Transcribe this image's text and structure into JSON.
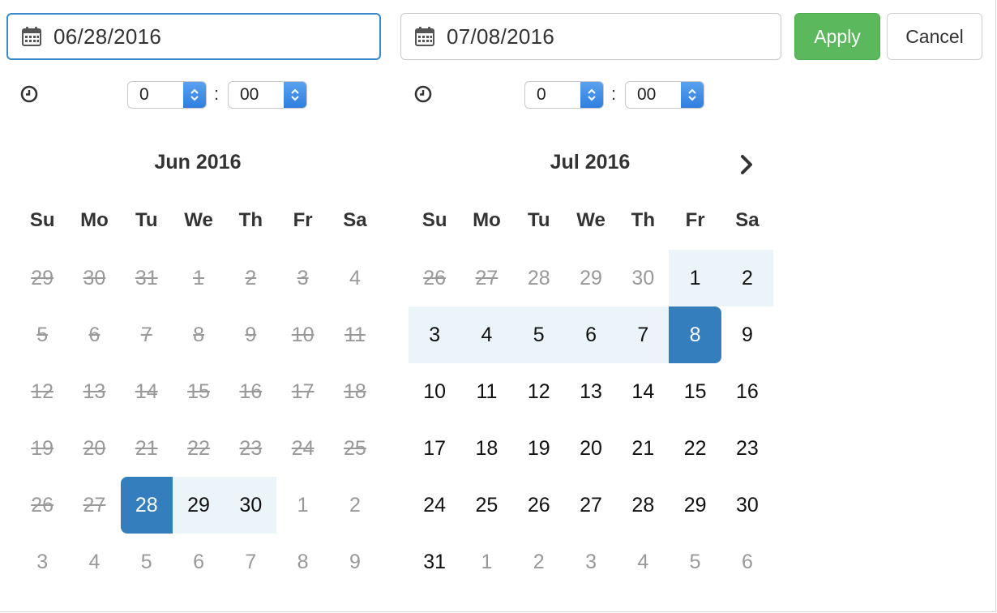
{
  "inputs": {
    "start_date": "06/28/2016",
    "end_date": "07/08/2016"
  },
  "buttons": {
    "apply": "Apply",
    "cancel": "Cancel"
  },
  "time": {
    "left": {
      "hour": "0",
      "separator": ":",
      "minute": "00"
    },
    "right": {
      "hour": "0",
      "separator": ":",
      "minute": "00"
    }
  },
  "icons": {
    "calendar": "calendar-icon",
    "clock": "clock-icon",
    "next": "chevron-right-icon",
    "select": "select-arrows-icon"
  },
  "colors": {
    "accent": "#357ebd",
    "range": "#ebf4f8",
    "apply": "#5cb85c",
    "focus_border": "#3a8ac9"
  },
  "weekdays": [
    "Su",
    "Mo",
    "Tu",
    "We",
    "Th",
    "Fr",
    "Sa"
  ],
  "calendars": [
    {
      "title": "Jun 2016",
      "days": [
        {
          "d": "29",
          "s": "disabled"
        },
        {
          "d": "30",
          "s": "disabled"
        },
        {
          "d": "31",
          "s": "disabled"
        },
        {
          "d": "1",
          "s": "disabled"
        },
        {
          "d": "2",
          "s": "disabled"
        },
        {
          "d": "3",
          "s": "disabled"
        },
        {
          "d": "4",
          "s": "off"
        },
        {
          "d": "5",
          "s": "disabled"
        },
        {
          "d": "6",
          "s": "disabled"
        },
        {
          "d": "7",
          "s": "disabled"
        },
        {
          "d": "8",
          "s": "disabled"
        },
        {
          "d": "9",
          "s": "disabled"
        },
        {
          "d": "10",
          "s": "disabled"
        },
        {
          "d": "11",
          "s": "disabled"
        },
        {
          "d": "12",
          "s": "disabled"
        },
        {
          "d": "13",
          "s": "disabled"
        },
        {
          "d": "14",
          "s": "disabled"
        },
        {
          "d": "15",
          "s": "disabled"
        },
        {
          "d": "16",
          "s": "disabled"
        },
        {
          "d": "17",
          "s": "disabled"
        },
        {
          "d": "18",
          "s": "disabled"
        },
        {
          "d": "19",
          "s": "disabled"
        },
        {
          "d": "20",
          "s": "disabled"
        },
        {
          "d": "21",
          "s": "disabled"
        },
        {
          "d": "22",
          "s": "disabled"
        },
        {
          "d": "23",
          "s": "disabled"
        },
        {
          "d": "24",
          "s": "disabled"
        },
        {
          "d": "25",
          "s": "disabled"
        },
        {
          "d": "26",
          "s": "disabled"
        },
        {
          "d": "27",
          "s": "disabled"
        },
        {
          "d": "28",
          "s": "start"
        },
        {
          "d": "29",
          "s": "in-range"
        },
        {
          "d": "30",
          "s": "in-range"
        },
        {
          "d": "1",
          "s": "off"
        },
        {
          "d": "2",
          "s": "off"
        },
        {
          "d": "3",
          "s": "off"
        },
        {
          "d": "4",
          "s": "off"
        },
        {
          "d": "5",
          "s": "off"
        },
        {
          "d": "6",
          "s": "off"
        },
        {
          "d": "7",
          "s": "off"
        },
        {
          "d": "8",
          "s": "off"
        },
        {
          "d": "9",
          "s": "off"
        }
      ]
    },
    {
      "title": "Jul 2016",
      "days": [
        {
          "d": "26",
          "s": "disabled"
        },
        {
          "d": "27",
          "s": "disabled"
        },
        {
          "d": "28",
          "s": "off"
        },
        {
          "d": "29",
          "s": "off"
        },
        {
          "d": "30",
          "s": "off"
        },
        {
          "d": "1",
          "s": "in-range"
        },
        {
          "d": "2",
          "s": "in-range"
        },
        {
          "d": "3",
          "s": "in-range"
        },
        {
          "d": "4",
          "s": "in-range"
        },
        {
          "d": "5",
          "s": "in-range"
        },
        {
          "d": "6",
          "s": "in-range"
        },
        {
          "d": "7",
          "s": "in-range"
        },
        {
          "d": "8",
          "s": "end"
        },
        {
          "d": "9",
          "s": "available"
        },
        {
          "d": "10",
          "s": "available"
        },
        {
          "d": "11",
          "s": "available"
        },
        {
          "d": "12",
          "s": "available"
        },
        {
          "d": "13",
          "s": "available"
        },
        {
          "d": "14",
          "s": "available"
        },
        {
          "d": "15",
          "s": "available"
        },
        {
          "d": "16",
          "s": "available"
        },
        {
          "d": "17",
          "s": "available"
        },
        {
          "d": "18",
          "s": "available"
        },
        {
          "d": "19",
          "s": "available"
        },
        {
          "d": "20",
          "s": "available"
        },
        {
          "d": "21",
          "s": "available"
        },
        {
          "d": "22",
          "s": "available"
        },
        {
          "d": "23",
          "s": "available"
        },
        {
          "d": "24",
          "s": "available"
        },
        {
          "d": "25",
          "s": "available"
        },
        {
          "d": "26",
          "s": "available"
        },
        {
          "d": "27",
          "s": "available"
        },
        {
          "d": "28",
          "s": "available"
        },
        {
          "d": "29",
          "s": "available"
        },
        {
          "d": "30",
          "s": "available"
        },
        {
          "d": "31",
          "s": "available"
        },
        {
          "d": "1",
          "s": "off"
        },
        {
          "d": "2",
          "s": "off"
        },
        {
          "d": "3",
          "s": "off"
        },
        {
          "d": "4",
          "s": "off"
        },
        {
          "d": "5",
          "s": "off"
        },
        {
          "d": "6",
          "s": "off"
        }
      ]
    }
  ]
}
